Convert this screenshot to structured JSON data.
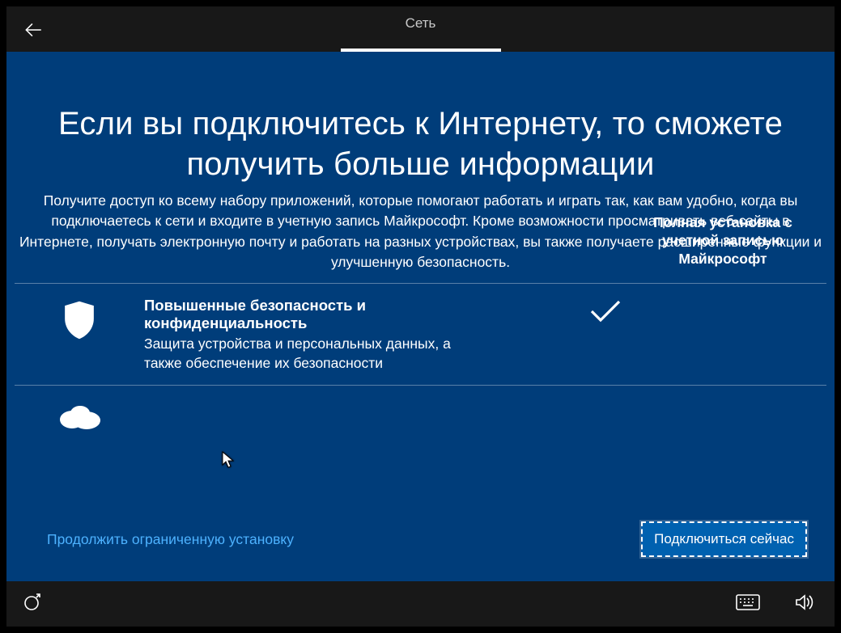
{
  "topbar": {
    "tab_label": "Сеть"
  },
  "headline": "Если вы подключитесь к Интернету, то сможете получить больше информации",
  "description": "Получите доступ ко всему набору приложений, которые помогают работать и играть так, как вам удобно, когда вы подключаетесь к сети и входите в учетную запись Майкрософт. Кроме возможности просматривать веб-сайты в Интернете, получать электронную почту и работать на разных устройствах, вы также получаете расширенные функции и улучшенную безопасность.",
  "column_header": "Полная установка с учетной записью Майкрософт",
  "items": [
    {
      "icon": "shield",
      "title": "Повышенные безопасность и конфиденциальность",
      "body": "Защита устройства и персональных данных, а также обеспечение их безопасности",
      "checked": true
    },
    {
      "icon": "onedrive",
      "title": "",
      "body": "",
      "checked": false
    }
  ],
  "footer": {
    "secondary_link": "Продолжить ограниченную установку",
    "primary_button": "Подключиться сейчас"
  }
}
